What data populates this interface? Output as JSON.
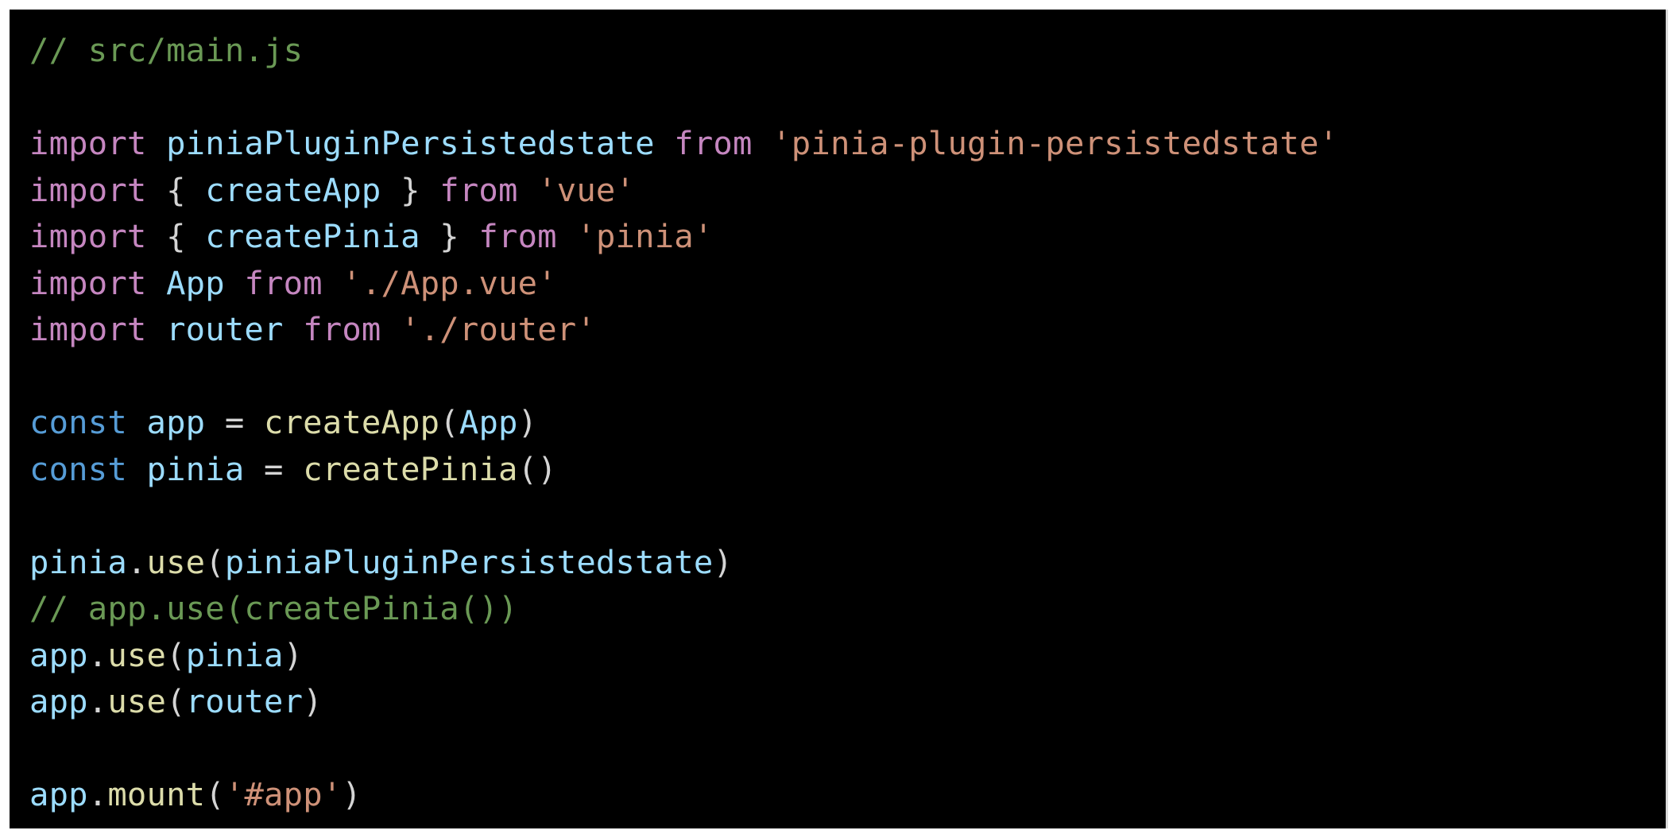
{
  "editor": {
    "language": "javascript",
    "theme": "dark",
    "colors": {
      "background": "#000000",
      "comment": "#6a9955",
      "keyword": "#c586c0",
      "storage": "#569cd6",
      "variable": "#9cdcfe",
      "function": "#dcdcaa",
      "string": "#ce9178",
      "punctuation": "#d4d4d4"
    },
    "lines": [
      [
        {
          "t": "comment",
          "v": "// src/main.js"
        }
      ],
      [],
      [
        {
          "t": "keyword",
          "v": "import"
        },
        {
          "t": "punct",
          "v": " "
        },
        {
          "t": "var",
          "v": "piniaPluginPersistedstate"
        },
        {
          "t": "punct",
          "v": " "
        },
        {
          "t": "keyword",
          "v": "from"
        },
        {
          "t": "punct",
          "v": " "
        },
        {
          "t": "string",
          "v": "'pinia-plugin-persistedstate'"
        }
      ],
      [
        {
          "t": "keyword",
          "v": "import"
        },
        {
          "t": "punct",
          "v": " { "
        },
        {
          "t": "var",
          "v": "createApp"
        },
        {
          "t": "punct",
          "v": " } "
        },
        {
          "t": "keyword",
          "v": "from"
        },
        {
          "t": "punct",
          "v": " "
        },
        {
          "t": "string",
          "v": "'vue'"
        }
      ],
      [
        {
          "t": "keyword",
          "v": "import"
        },
        {
          "t": "punct",
          "v": " { "
        },
        {
          "t": "var",
          "v": "createPinia"
        },
        {
          "t": "punct",
          "v": " } "
        },
        {
          "t": "keyword",
          "v": "from"
        },
        {
          "t": "punct",
          "v": " "
        },
        {
          "t": "string",
          "v": "'pinia'"
        }
      ],
      [
        {
          "t": "keyword",
          "v": "import"
        },
        {
          "t": "punct",
          "v": " "
        },
        {
          "t": "var",
          "v": "App"
        },
        {
          "t": "punct",
          "v": " "
        },
        {
          "t": "keyword",
          "v": "from"
        },
        {
          "t": "punct",
          "v": " "
        },
        {
          "t": "string",
          "v": "'./App.vue'"
        }
      ],
      [
        {
          "t": "keyword",
          "v": "import"
        },
        {
          "t": "punct",
          "v": " "
        },
        {
          "t": "var",
          "v": "router"
        },
        {
          "t": "punct",
          "v": " "
        },
        {
          "t": "keyword",
          "v": "from"
        },
        {
          "t": "punct",
          "v": " "
        },
        {
          "t": "string",
          "v": "'./router'"
        }
      ],
      [],
      [
        {
          "t": "storage",
          "v": "const"
        },
        {
          "t": "punct",
          "v": " "
        },
        {
          "t": "var",
          "v": "app"
        },
        {
          "t": "punct",
          "v": " = "
        },
        {
          "t": "func",
          "v": "createApp"
        },
        {
          "t": "punct",
          "v": "("
        },
        {
          "t": "var",
          "v": "App"
        },
        {
          "t": "punct",
          "v": ")"
        }
      ],
      [
        {
          "t": "storage",
          "v": "const"
        },
        {
          "t": "punct",
          "v": " "
        },
        {
          "t": "var",
          "v": "pinia"
        },
        {
          "t": "punct",
          "v": " = "
        },
        {
          "t": "func",
          "v": "createPinia"
        },
        {
          "t": "punct",
          "v": "()"
        }
      ],
      [],
      [
        {
          "t": "var",
          "v": "pinia"
        },
        {
          "t": "punct",
          "v": "."
        },
        {
          "t": "func",
          "v": "use"
        },
        {
          "t": "punct",
          "v": "("
        },
        {
          "t": "var",
          "v": "piniaPluginPersistedstate"
        },
        {
          "t": "punct",
          "v": ")"
        }
      ],
      [
        {
          "t": "comment",
          "v": "// app.use(createPinia())"
        }
      ],
      [
        {
          "t": "var",
          "v": "app"
        },
        {
          "t": "punct",
          "v": "."
        },
        {
          "t": "func",
          "v": "use"
        },
        {
          "t": "punct",
          "v": "("
        },
        {
          "t": "var",
          "v": "pinia"
        },
        {
          "t": "punct",
          "v": ")"
        }
      ],
      [
        {
          "t": "var",
          "v": "app"
        },
        {
          "t": "punct",
          "v": "."
        },
        {
          "t": "func",
          "v": "use"
        },
        {
          "t": "punct",
          "v": "("
        },
        {
          "t": "var",
          "v": "router"
        },
        {
          "t": "punct",
          "v": ")"
        }
      ],
      [],
      [
        {
          "t": "var",
          "v": "app"
        },
        {
          "t": "punct",
          "v": "."
        },
        {
          "t": "func",
          "v": "mount"
        },
        {
          "t": "punct",
          "v": "("
        },
        {
          "t": "string",
          "v": "'#app'"
        },
        {
          "t": "punct",
          "v": ")"
        }
      ]
    ]
  }
}
